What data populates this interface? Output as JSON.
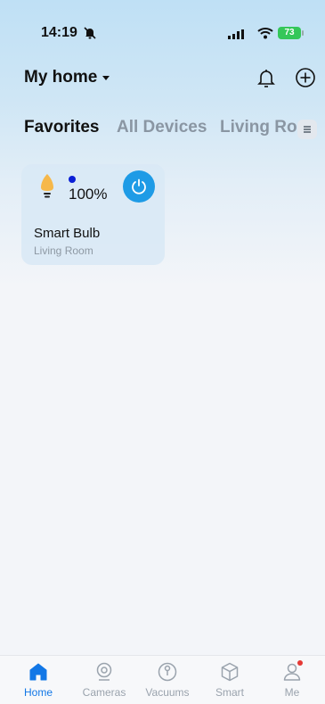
{
  "status_bar": {
    "time": "14:19",
    "battery": "73"
  },
  "header": {
    "home_title": "My home"
  },
  "tabs": [
    {
      "label": "Favorites",
      "active": true
    },
    {
      "label": "All Devices",
      "active": false
    },
    {
      "label": "Living Room",
      "active": false
    }
  ],
  "devices": [
    {
      "name": "Smart Bulb",
      "room": "Living Room",
      "brightness": "100%",
      "power_on": true
    }
  ],
  "bottom_nav": [
    {
      "label": "Home",
      "icon": "home-icon",
      "active": true
    },
    {
      "label": "Cameras",
      "icon": "camera-icon",
      "active": false
    },
    {
      "label": "Vacuums",
      "icon": "vacuum-icon",
      "active": false
    },
    {
      "label": "Smart",
      "icon": "cube-icon",
      "active": false
    },
    {
      "label": "Me",
      "icon": "person-icon",
      "active": false,
      "badge": true
    }
  ],
  "colors": {
    "accent": "#1277e6",
    "power_button": "#1e9be6",
    "badge": "#e53935",
    "battery": "#34c759"
  }
}
